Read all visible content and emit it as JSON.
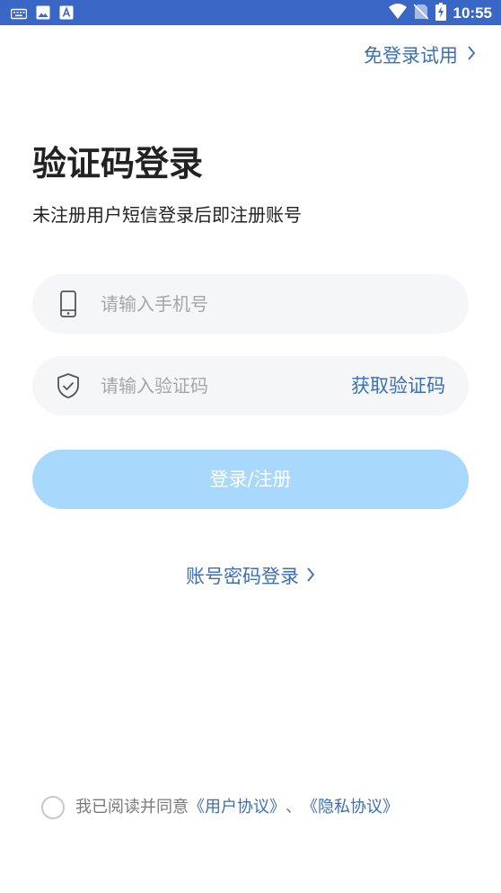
{
  "status_bar": {
    "time": "10:55",
    "left_icons": [
      "keyboard-icon",
      "image-icon",
      "text-a-icon"
    ],
    "right_icons": [
      "wifi-icon",
      "no-sim-icon",
      "battery-charging-icon"
    ],
    "background": "#3a66c6"
  },
  "header": {
    "trial_link": "免登录试用"
  },
  "login": {
    "title": "验证码登录",
    "subtitle": "未注册用户短信登录后即注册账号",
    "phone_placeholder": "请输入手机号",
    "code_placeholder": "请输入验证码",
    "get_code": "获取验证码",
    "submit": "登录/注册",
    "password_login": "账号密码登录"
  },
  "agreement": {
    "prefix": "我已阅读并同意",
    "user_agreement": "《用户协议》",
    "separator": "、",
    "privacy_policy": "《隐私协议》"
  },
  "colors": {
    "accent": "#3b6fb6",
    "button_disabled": "#a8d8fb",
    "field_bg": "#f5f6f7",
    "placeholder": "#a6a6a6",
    "text": "#222222"
  }
}
